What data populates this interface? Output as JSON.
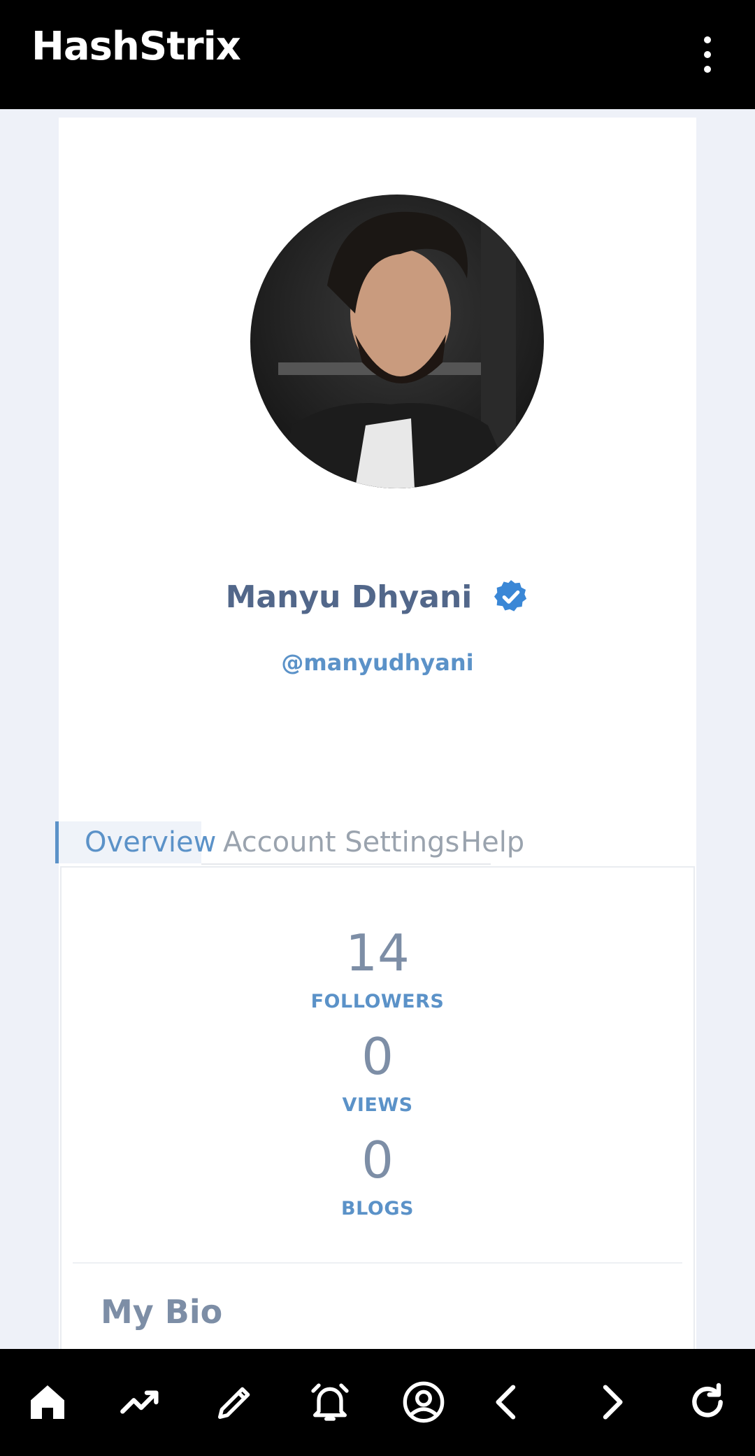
{
  "header": {
    "title": "HashStrix",
    "menu_icon": "more-vert-icon"
  },
  "profile": {
    "name": "Manyu Dhyani",
    "handle": "@manyudhyani",
    "verified_icon": "verified-badge-icon",
    "accent_color": "#5b92c8"
  },
  "tabs": [
    {
      "label": "Overview",
      "active": true
    },
    {
      "label": "Account Settings",
      "active": false
    },
    {
      "label": "Help",
      "active": false
    }
  ],
  "stats": [
    {
      "value": "14",
      "label": "FOLLOWERS"
    },
    {
      "value": "0",
      "label": "VIEWS"
    },
    {
      "value": "0",
      "label": "BLOGS"
    }
  ],
  "bio": {
    "title": "My Bio"
  },
  "bottom_nav": [
    {
      "icon": "home-icon"
    },
    {
      "icon": "trending-icon"
    },
    {
      "icon": "edit-pencil-icon"
    },
    {
      "icon": "alarm-bell-icon"
    },
    {
      "icon": "account-circle-icon"
    },
    {
      "icon": "back-arrow-icon"
    },
    {
      "icon": "forward-arrow-icon"
    },
    {
      "icon": "refresh-icon"
    }
  ]
}
